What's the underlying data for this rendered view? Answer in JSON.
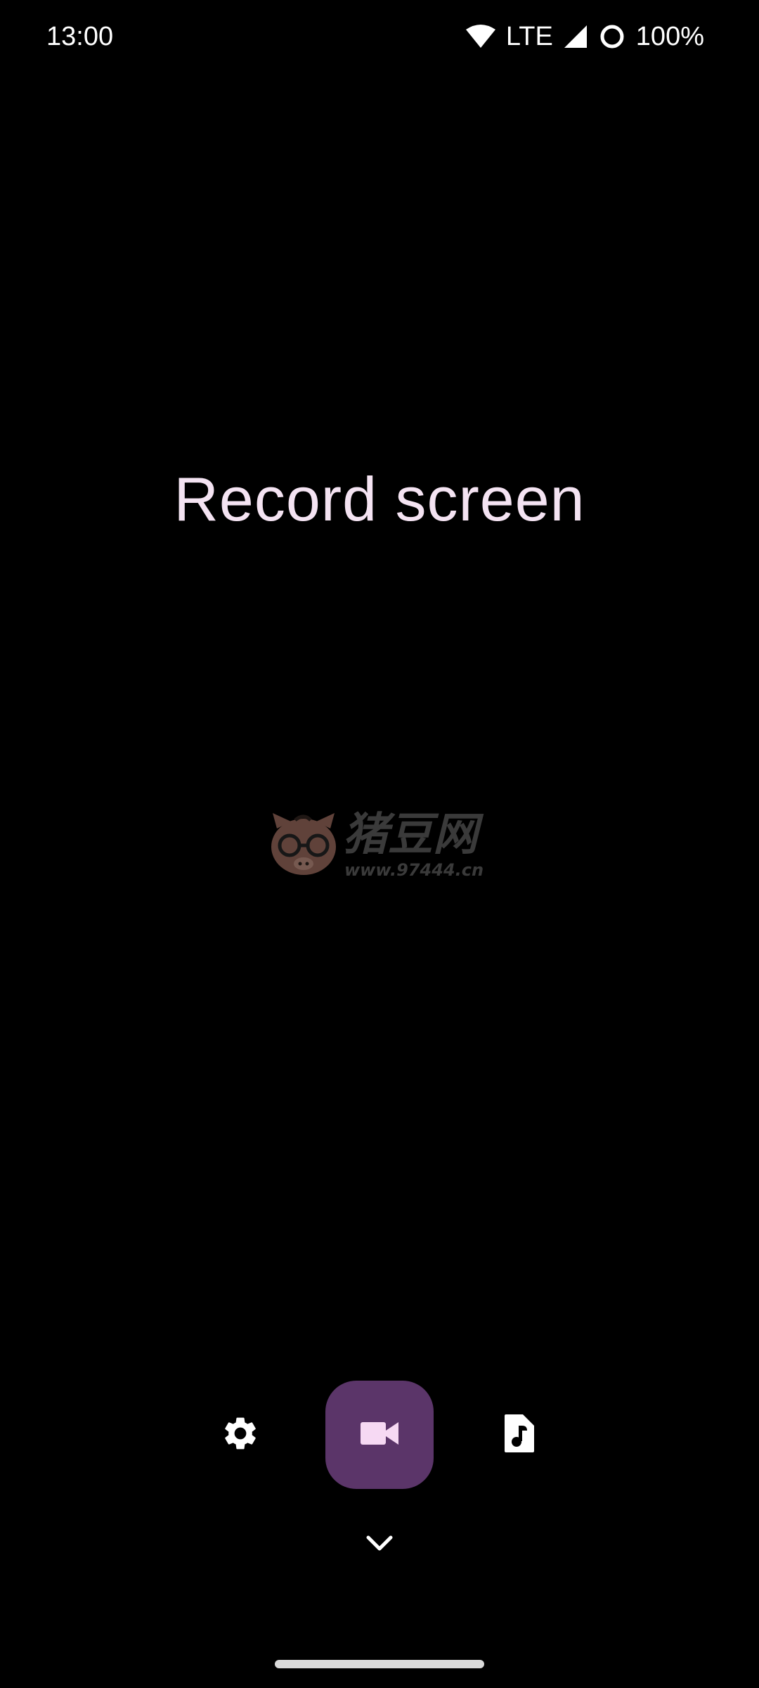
{
  "status_bar": {
    "time": "13:00",
    "network": "LTE",
    "battery": "100%",
    "icons": [
      "wifi-icon",
      "signal-icon",
      "battery-saver-icon"
    ]
  },
  "main": {
    "title": "Record screen"
  },
  "watermark": {
    "text": "猪豆网",
    "url": "www.97444.cn",
    "icon": "pig-logo-icon"
  },
  "controls": {
    "settings_icon": "gear-icon",
    "record_icon": "videocam-icon",
    "audio_icon": "audio-file-icon",
    "expand_icon": "chevron-down-icon"
  },
  "colors": {
    "background": "#000000",
    "title_text": "#f4e3f2",
    "record_button": "#5b3569",
    "record_icon": "#f6d9f3",
    "icon": "#ffffff"
  }
}
